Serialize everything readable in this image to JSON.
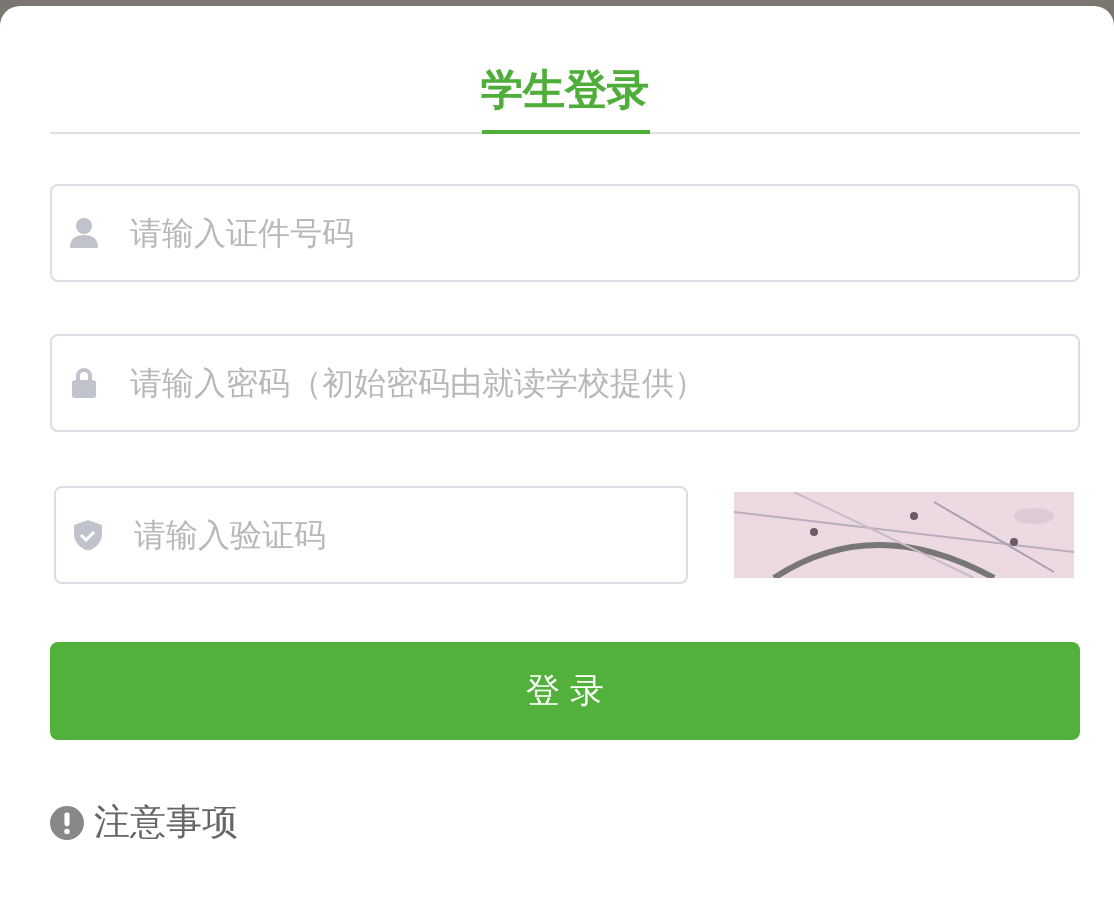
{
  "tabs": [
    {
      "label": "学生登录",
      "selected": true
    }
  ],
  "fields": [
    {
      "kind": "user",
      "placeholder": "请输入证件号码"
    },
    {
      "kind": "lock",
      "placeholder": "请输入密码（初始密码由就读学校提供）"
    }
  ],
  "captcha": {
    "placeholder": "请输入验证码"
  },
  "login_button": "登 录",
  "notice": "注意事项"
}
